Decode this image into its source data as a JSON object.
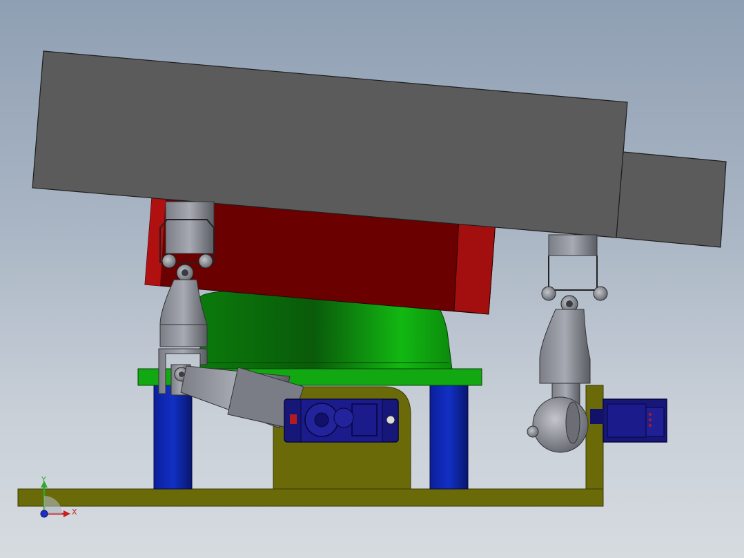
{
  "viewport": {
    "background_top": "#8f9fb3",
    "background_bottom": "#d6dbe0"
  },
  "triad": {
    "y_label": "Y",
    "x_label": "X",
    "y_color": "#2ea82e",
    "x_color": "#c81e1e",
    "z_color": "#1e2ec8"
  },
  "parts": {
    "top_plate": {
      "color": "#5b5b5b"
    },
    "red_block": {
      "color": "#6b0000"
    },
    "green_dome": {
      "color": "#0ca00c"
    },
    "blue_posts": {
      "color": "#0b1f9a"
    },
    "yellow_base": {
      "color": "#6b6a08"
    },
    "servo_motors": {
      "color": "#17177a"
    },
    "linkages": {
      "color": "#6c6e76"
    }
  }
}
